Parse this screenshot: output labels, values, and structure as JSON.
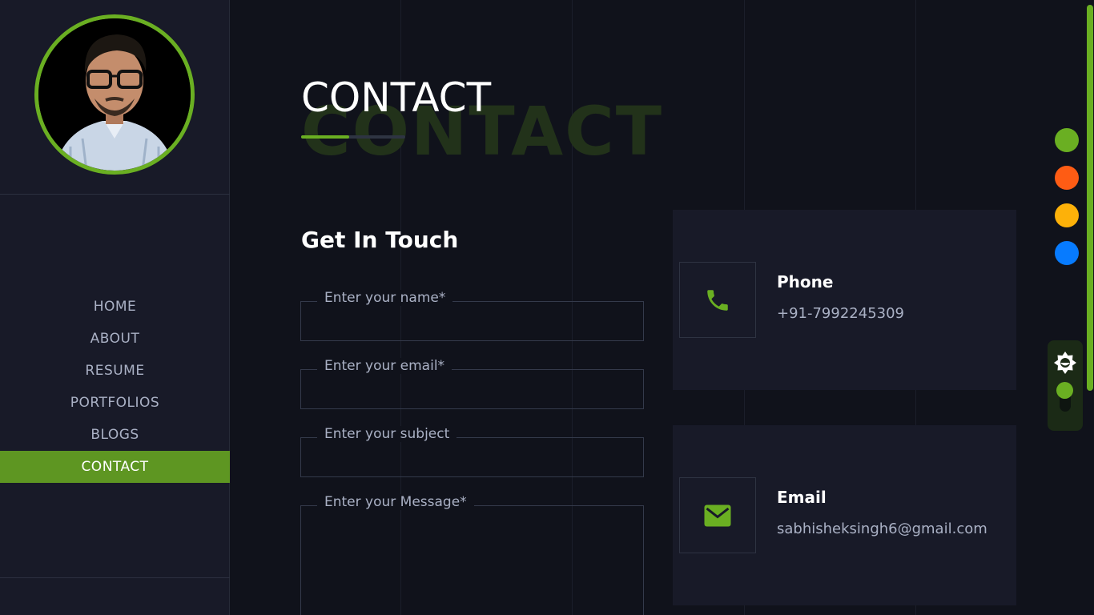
{
  "sidebar": {
    "nav": [
      {
        "label": "HOME"
      },
      {
        "label": "ABOUT"
      },
      {
        "label": "RESUME"
      },
      {
        "label": "PORTFOLIOS"
      },
      {
        "label": "BLOGS"
      },
      {
        "label": "CONTACT",
        "active": true
      }
    ]
  },
  "page": {
    "title": "CONTACT",
    "title_background": "CONTACT",
    "subtitle": "Get In Touch"
  },
  "form": {
    "name_label": "Enter your name*",
    "email_label": "Enter your email*",
    "subject_label": "Enter your subject",
    "message_label": "Enter your Message*"
  },
  "contact": {
    "phone": {
      "title": "Phone",
      "value": "+91-7992245309",
      "icon": "phone-icon"
    },
    "email": {
      "title": "Email",
      "value": "sabhisheksingh6@gmail.com",
      "icon": "mail-icon"
    }
  },
  "theme": {
    "accent": "#6aaf22",
    "color_options": [
      "#6aaf22",
      "#fe5c14",
      "#fdb109",
      "#077bff"
    ],
    "mode_icon": "sun-icon"
  }
}
